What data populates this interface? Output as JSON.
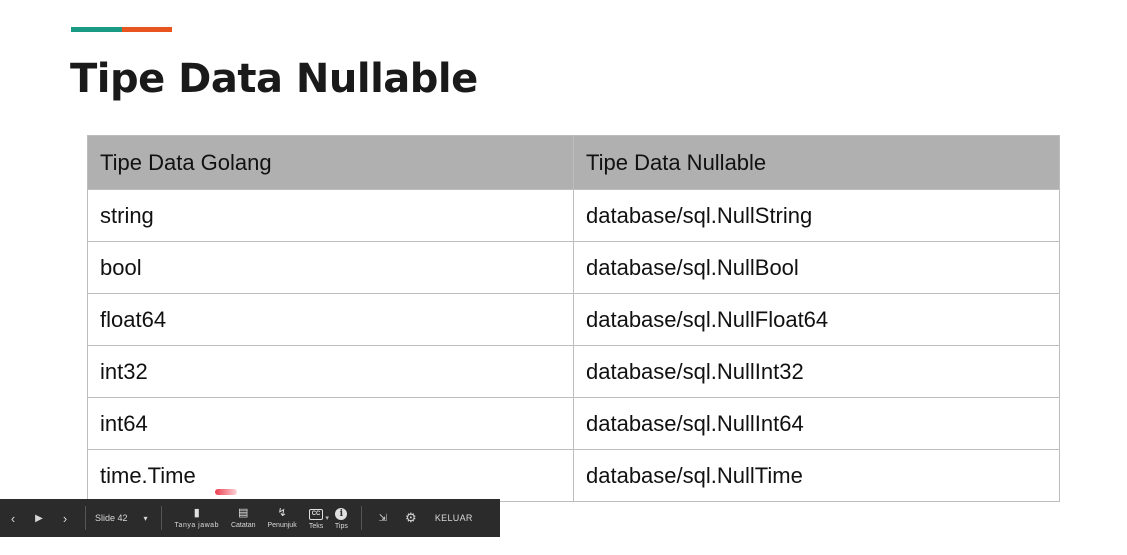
{
  "slide": {
    "title": "Tipe Data Nullable",
    "accent_colors": [
      "#1a9a84",
      "#e8541e"
    ]
  },
  "table": {
    "headers": [
      "Tipe Data Golang",
      "Tipe Data Nullable"
    ],
    "rows": [
      [
        "string",
        "database/sql.NullString"
      ],
      [
        "bool",
        "database/sql.NullBool"
      ],
      [
        "float64",
        "database/sql.NullFloat64"
      ],
      [
        "int32",
        "database/sql.NullInt32"
      ],
      [
        "int64",
        "database/sql.NullInt64"
      ],
      [
        "time.Time",
        "database/sql.NullTime"
      ]
    ]
  },
  "toolbar": {
    "prev_icon": "chevron-left-icon",
    "play_icon": "play-icon",
    "next_icon": "chevron-right-icon",
    "slide_label": "Slide 42",
    "qa_label": "Tanya jawab",
    "notes_label": "Catatan",
    "pointer_label": "Penunjuk",
    "captions_label": "Teks",
    "tips_label": "Tips",
    "exit_label": "KELUAR"
  }
}
